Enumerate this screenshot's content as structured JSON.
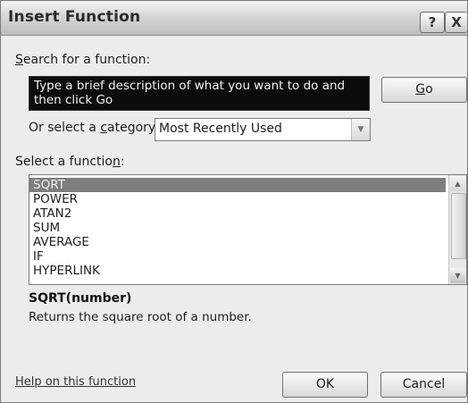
{
  "window": {
    "title": "Insert Function",
    "help_glyph": "?",
    "close_glyph": "X"
  },
  "search": {
    "label_prefix": "",
    "label_key": "S",
    "label_rest": "earch for a function:",
    "value": "Type a brief description of what you want to do and then click Go",
    "go_key": "G",
    "go_rest": "o"
  },
  "category": {
    "label_prefix": "Or select a ",
    "label_key": "c",
    "label_rest": "ategory:",
    "selected": "Most Recently Used"
  },
  "functions": {
    "label_prefix": "Select a functio",
    "label_key": "n",
    "label_rest": ":",
    "items": [
      "SQRT",
      "POWER",
      "ATAN2",
      "SUM",
      "AVERAGE",
      "IF",
      "HYPERLINK"
    ],
    "selected_index": 0
  },
  "details": {
    "syntax": "SQRT(number)",
    "description": "Returns the square root of a number."
  },
  "footer": {
    "help_link": "Help on this function",
    "ok_label": "OK",
    "cancel_label": "Cancel"
  }
}
